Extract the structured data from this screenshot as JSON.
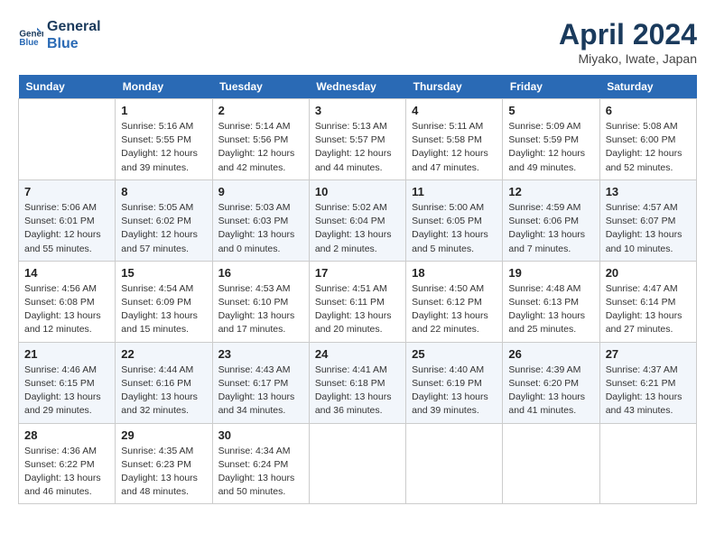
{
  "header": {
    "logo_line1": "General",
    "logo_line2": "Blue",
    "month": "April 2024",
    "location": "Miyako, Iwate, Japan"
  },
  "weekdays": [
    "Sunday",
    "Monday",
    "Tuesday",
    "Wednesday",
    "Thursday",
    "Friday",
    "Saturday"
  ],
  "weeks": [
    [
      {
        "day": "",
        "empty": true
      },
      {
        "day": "1",
        "sunrise": "5:16 AM",
        "sunset": "5:55 PM",
        "daylight": "12 hours and 39 minutes."
      },
      {
        "day": "2",
        "sunrise": "5:14 AM",
        "sunset": "5:56 PM",
        "daylight": "12 hours and 42 minutes."
      },
      {
        "day": "3",
        "sunrise": "5:13 AM",
        "sunset": "5:57 PM",
        "daylight": "12 hours and 44 minutes."
      },
      {
        "day": "4",
        "sunrise": "5:11 AM",
        "sunset": "5:58 PM",
        "daylight": "12 hours and 47 minutes."
      },
      {
        "day": "5",
        "sunrise": "5:09 AM",
        "sunset": "5:59 PM",
        "daylight": "12 hours and 49 minutes."
      },
      {
        "day": "6",
        "sunrise": "5:08 AM",
        "sunset": "6:00 PM",
        "daylight": "12 hours and 52 minutes."
      }
    ],
    [
      {
        "day": "7",
        "sunrise": "5:06 AM",
        "sunset": "6:01 PM",
        "daylight": "12 hours and 55 minutes."
      },
      {
        "day": "8",
        "sunrise": "5:05 AM",
        "sunset": "6:02 PM",
        "daylight": "12 hours and 57 minutes."
      },
      {
        "day": "9",
        "sunrise": "5:03 AM",
        "sunset": "6:03 PM",
        "daylight": "13 hours and 0 minutes."
      },
      {
        "day": "10",
        "sunrise": "5:02 AM",
        "sunset": "6:04 PM",
        "daylight": "13 hours and 2 minutes."
      },
      {
        "day": "11",
        "sunrise": "5:00 AM",
        "sunset": "6:05 PM",
        "daylight": "13 hours and 5 minutes."
      },
      {
        "day": "12",
        "sunrise": "4:59 AM",
        "sunset": "6:06 PM",
        "daylight": "13 hours and 7 minutes."
      },
      {
        "day": "13",
        "sunrise": "4:57 AM",
        "sunset": "6:07 PM",
        "daylight": "13 hours and 10 minutes."
      }
    ],
    [
      {
        "day": "14",
        "sunrise": "4:56 AM",
        "sunset": "6:08 PM",
        "daylight": "13 hours and 12 minutes."
      },
      {
        "day": "15",
        "sunrise": "4:54 AM",
        "sunset": "6:09 PM",
        "daylight": "13 hours and 15 minutes."
      },
      {
        "day": "16",
        "sunrise": "4:53 AM",
        "sunset": "6:10 PM",
        "daylight": "13 hours and 17 minutes."
      },
      {
        "day": "17",
        "sunrise": "4:51 AM",
        "sunset": "6:11 PM",
        "daylight": "13 hours and 20 minutes."
      },
      {
        "day": "18",
        "sunrise": "4:50 AM",
        "sunset": "6:12 PM",
        "daylight": "13 hours and 22 minutes."
      },
      {
        "day": "19",
        "sunrise": "4:48 AM",
        "sunset": "6:13 PM",
        "daylight": "13 hours and 25 minutes."
      },
      {
        "day": "20",
        "sunrise": "4:47 AM",
        "sunset": "6:14 PM",
        "daylight": "13 hours and 27 minutes."
      }
    ],
    [
      {
        "day": "21",
        "sunrise": "4:46 AM",
        "sunset": "6:15 PM",
        "daylight": "13 hours and 29 minutes."
      },
      {
        "day": "22",
        "sunrise": "4:44 AM",
        "sunset": "6:16 PM",
        "daylight": "13 hours and 32 minutes."
      },
      {
        "day": "23",
        "sunrise": "4:43 AM",
        "sunset": "6:17 PM",
        "daylight": "13 hours and 34 minutes."
      },
      {
        "day": "24",
        "sunrise": "4:41 AM",
        "sunset": "6:18 PM",
        "daylight": "13 hours and 36 minutes."
      },
      {
        "day": "25",
        "sunrise": "4:40 AM",
        "sunset": "6:19 PM",
        "daylight": "13 hours and 39 minutes."
      },
      {
        "day": "26",
        "sunrise": "4:39 AM",
        "sunset": "6:20 PM",
        "daylight": "13 hours and 41 minutes."
      },
      {
        "day": "27",
        "sunrise": "4:37 AM",
        "sunset": "6:21 PM",
        "daylight": "13 hours and 43 minutes."
      }
    ],
    [
      {
        "day": "28",
        "sunrise": "4:36 AM",
        "sunset": "6:22 PM",
        "daylight": "13 hours and 46 minutes."
      },
      {
        "day": "29",
        "sunrise": "4:35 AM",
        "sunset": "6:23 PM",
        "daylight": "13 hours and 48 minutes."
      },
      {
        "day": "30",
        "sunrise": "4:34 AM",
        "sunset": "6:24 PM",
        "daylight": "13 hours and 50 minutes."
      },
      {
        "day": "",
        "empty": true
      },
      {
        "day": "",
        "empty": true
      },
      {
        "day": "",
        "empty": true
      },
      {
        "day": "",
        "empty": true
      }
    ]
  ],
  "labels": {
    "sunrise": "Sunrise: ",
    "sunset": "Sunset: ",
    "daylight": "Daylight: "
  }
}
